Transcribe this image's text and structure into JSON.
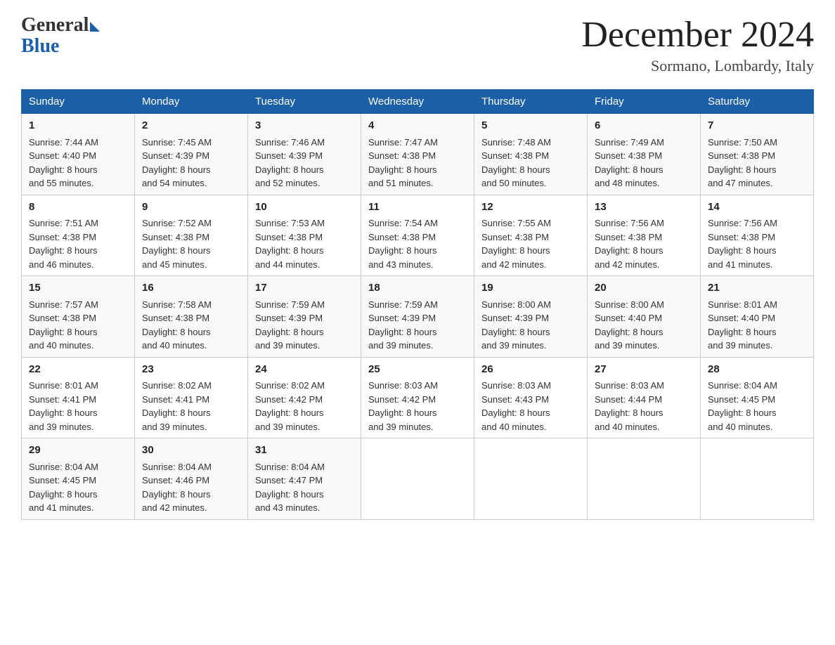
{
  "header": {
    "logo_general": "General",
    "logo_blue": "Blue",
    "month_title": "December 2024",
    "location": "Sormano, Lombardy, Italy"
  },
  "days_of_week": [
    "Sunday",
    "Monday",
    "Tuesday",
    "Wednesday",
    "Thursday",
    "Friday",
    "Saturday"
  ],
  "weeks": [
    [
      {
        "day": "1",
        "sunrise": "7:44 AM",
        "sunset": "4:40 PM",
        "daylight": "8 hours and 55 minutes."
      },
      {
        "day": "2",
        "sunrise": "7:45 AM",
        "sunset": "4:39 PM",
        "daylight": "8 hours and 54 minutes."
      },
      {
        "day": "3",
        "sunrise": "7:46 AM",
        "sunset": "4:39 PM",
        "daylight": "8 hours and 52 minutes."
      },
      {
        "day": "4",
        "sunrise": "7:47 AM",
        "sunset": "4:38 PM",
        "daylight": "8 hours and 51 minutes."
      },
      {
        "day": "5",
        "sunrise": "7:48 AM",
        "sunset": "4:38 PM",
        "daylight": "8 hours and 50 minutes."
      },
      {
        "day": "6",
        "sunrise": "7:49 AM",
        "sunset": "4:38 PM",
        "daylight": "8 hours and 48 minutes."
      },
      {
        "day": "7",
        "sunrise": "7:50 AM",
        "sunset": "4:38 PM",
        "daylight": "8 hours and 47 minutes."
      }
    ],
    [
      {
        "day": "8",
        "sunrise": "7:51 AM",
        "sunset": "4:38 PM",
        "daylight": "8 hours and 46 minutes."
      },
      {
        "day": "9",
        "sunrise": "7:52 AM",
        "sunset": "4:38 PM",
        "daylight": "8 hours and 45 minutes."
      },
      {
        "day": "10",
        "sunrise": "7:53 AM",
        "sunset": "4:38 PM",
        "daylight": "8 hours and 44 minutes."
      },
      {
        "day": "11",
        "sunrise": "7:54 AM",
        "sunset": "4:38 PM",
        "daylight": "8 hours and 43 minutes."
      },
      {
        "day": "12",
        "sunrise": "7:55 AM",
        "sunset": "4:38 PM",
        "daylight": "8 hours and 42 minutes."
      },
      {
        "day": "13",
        "sunrise": "7:56 AM",
        "sunset": "4:38 PM",
        "daylight": "8 hours and 42 minutes."
      },
      {
        "day": "14",
        "sunrise": "7:56 AM",
        "sunset": "4:38 PM",
        "daylight": "8 hours and 41 minutes."
      }
    ],
    [
      {
        "day": "15",
        "sunrise": "7:57 AM",
        "sunset": "4:38 PM",
        "daylight": "8 hours and 40 minutes."
      },
      {
        "day": "16",
        "sunrise": "7:58 AM",
        "sunset": "4:38 PM",
        "daylight": "8 hours and 40 minutes."
      },
      {
        "day": "17",
        "sunrise": "7:59 AM",
        "sunset": "4:39 PM",
        "daylight": "8 hours and 39 minutes."
      },
      {
        "day": "18",
        "sunrise": "7:59 AM",
        "sunset": "4:39 PM",
        "daylight": "8 hours and 39 minutes."
      },
      {
        "day": "19",
        "sunrise": "8:00 AM",
        "sunset": "4:39 PM",
        "daylight": "8 hours and 39 minutes."
      },
      {
        "day": "20",
        "sunrise": "8:00 AM",
        "sunset": "4:40 PM",
        "daylight": "8 hours and 39 minutes."
      },
      {
        "day": "21",
        "sunrise": "8:01 AM",
        "sunset": "4:40 PM",
        "daylight": "8 hours and 39 minutes."
      }
    ],
    [
      {
        "day": "22",
        "sunrise": "8:01 AM",
        "sunset": "4:41 PM",
        "daylight": "8 hours and 39 minutes."
      },
      {
        "day": "23",
        "sunrise": "8:02 AM",
        "sunset": "4:41 PM",
        "daylight": "8 hours and 39 minutes."
      },
      {
        "day": "24",
        "sunrise": "8:02 AM",
        "sunset": "4:42 PM",
        "daylight": "8 hours and 39 minutes."
      },
      {
        "day": "25",
        "sunrise": "8:03 AM",
        "sunset": "4:42 PM",
        "daylight": "8 hours and 39 minutes."
      },
      {
        "day": "26",
        "sunrise": "8:03 AM",
        "sunset": "4:43 PM",
        "daylight": "8 hours and 40 minutes."
      },
      {
        "day": "27",
        "sunrise": "8:03 AM",
        "sunset": "4:44 PM",
        "daylight": "8 hours and 40 minutes."
      },
      {
        "day": "28",
        "sunrise": "8:04 AM",
        "sunset": "4:45 PM",
        "daylight": "8 hours and 40 minutes."
      }
    ],
    [
      {
        "day": "29",
        "sunrise": "8:04 AM",
        "sunset": "4:45 PM",
        "daylight": "8 hours and 41 minutes."
      },
      {
        "day": "30",
        "sunrise": "8:04 AM",
        "sunset": "4:46 PM",
        "daylight": "8 hours and 42 minutes."
      },
      {
        "day": "31",
        "sunrise": "8:04 AM",
        "sunset": "4:47 PM",
        "daylight": "8 hours and 43 minutes."
      },
      null,
      null,
      null,
      null
    ]
  ],
  "labels": {
    "sunrise": "Sunrise:",
    "sunset": "Sunset:",
    "daylight": "Daylight:"
  }
}
